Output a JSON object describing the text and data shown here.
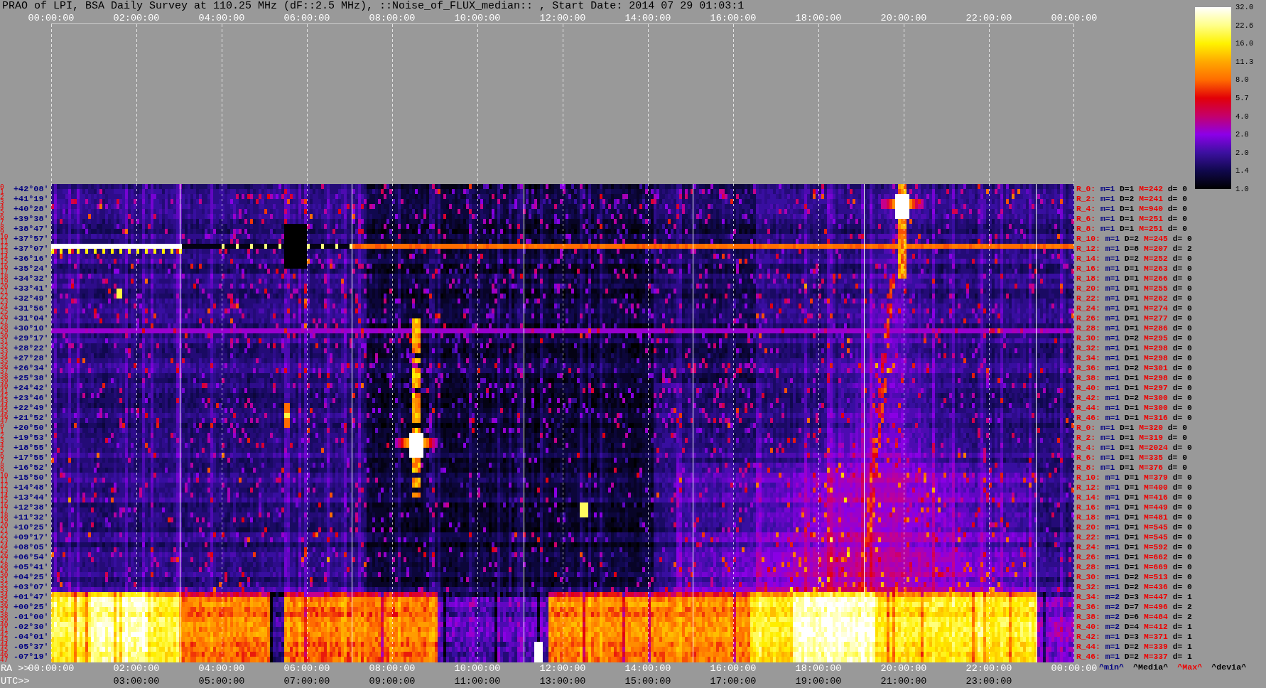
{
  "title": "PRAO of LPI, BSA Daily Survey at 110.25 MHz (dF::2.5 MHz), ::Noise_of_FLUX_median:: , Start Date: 2014 07 29 01:03:1",
  "top_axis": {
    "ticks": [
      "00:00:00",
      "02:00:00",
      "04:00:00",
      "06:00:00",
      "08:00:00",
      "10:00:00",
      "12:00:00",
      "14:00:00",
      "16:00:00",
      "18:00:00",
      "20:00:00",
      "22:00:00",
      "00:00:00"
    ]
  },
  "color_scale": {
    "ticks": [
      "32.0",
      "22.6",
      "16.0",
      "11.3",
      "8.0",
      "5.7",
      "4.0",
      "2.8",
      "2.0",
      "1.4",
      "1.0"
    ]
  },
  "declination_rows": [
    {
      "beams": [
        "0",
        "1"
      ],
      "declination": "+42°08′"
    },
    {
      "beams": [
        "2",
        "3"
      ],
      "declination": "+41°19′"
    },
    {
      "beams": [
        "4",
        "5"
      ],
      "declination": "+40°28′"
    },
    {
      "beams": [
        "6",
        "7"
      ],
      "declination": "+39°38′"
    },
    {
      "beams": [
        "8",
        "9"
      ],
      "declination": "+38°47′"
    },
    {
      "beams": [
        "10",
        "11"
      ],
      "declination": "+37°57′"
    },
    {
      "beams": [
        "12",
        "13"
      ],
      "declination": "+37°07′"
    },
    {
      "beams": [
        "14",
        "15"
      ],
      "declination": "+36°16′"
    },
    {
      "beams": [
        "16",
        "17"
      ],
      "declination": "+35°24′"
    },
    {
      "beams": [
        "18",
        "19"
      ],
      "declination": "+34°32′"
    },
    {
      "beams": [
        "20",
        "21"
      ],
      "declination": "+33°41′"
    },
    {
      "beams": [
        "22",
        "23"
      ],
      "declination": "+32°49′"
    },
    {
      "beams": [
        "24",
        "25"
      ],
      "declination": "+31°56′"
    },
    {
      "beams": [
        "26",
        "27"
      ],
      "declination": "+31°04′"
    },
    {
      "beams": [
        "28",
        "29"
      ],
      "declination": "+30°10′"
    },
    {
      "beams": [
        "30",
        "31"
      ],
      "declination": "+29°17′"
    },
    {
      "beams": [
        "32",
        "33"
      ],
      "declination": "+28°22′"
    },
    {
      "beams": [
        "34",
        "35"
      ],
      "declination": "+27°28′"
    },
    {
      "beams": [
        "36",
        "37"
      ],
      "declination": "+26°34′"
    },
    {
      "beams": [
        "38",
        "39"
      ],
      "declination": "+25°38′"
    },
    {
      "beams": [
        "40",
        "41"
      ],
      "declination": "+24°42′"
    },
    {
      "beams": [
        "42",
        "43"
      ],
      "declination": "+23°46′"
    },
    {
      "beams": [
        "44",
        "45"
      ],
      "declination": "+22°49′"
    },
    {
      "beams": [
        "46",
        "47"
      ],
      "declination": "+21°52′"
    },
    {
      "beams": [
        "0",
        "1"
      ],
      "declination": "+20°50′"
    },
    {
      "beams": [
        "2",
        "3"
      ],
      "declination": "+19°53′"
    },
    {
      "beams": [
        "4",
        "5"
      ],
      "declination": "+18°55′"
    },
    {
      "beams": [
        "6",
        "7"
      ],
      "declination": "+17°55′"
    },
    {
      "beams": [
        "8",
        "9"
      ],
      "declination": "+16°52′"
    },
    {
      "beams": [
        "10",
        "11"
      ],
      "declination": "+15°50′"
    },
    {
      "beams": [
        "12",
        "13"
      ],
      "declination": "+14°48′"
    },
    {
      "beams": [
        "14",
        "15"
      ],
      "declination": "+13°44′"
    },
    {
      "beams": [
        "16",
        "17"
      ],
      "declination": "+12°38′"
    },
    {
      "beams": [
        "18",
        "19"
      ],
      "declination": "+11°32′"
    },
    {
      "beams": [
        "20",
        "21"
      ],
      "declination": "+10°25′"
    },
    {
      "beams": [
        "22",
        "23"
      ],
      "declination": "+09°17′"
    },
    {
      "beams": [
        "24",
        "25"
      ],
      "declination": "+08°05′"
    },
    {
      "beams": [
        "26",
        "27"
      ],
      "declination": "+06°54′"
    },
    {
      "beams": [
        "28",
        "29"
      ],
      "declination": "+05°41′"
    },
    {
      "beams": [
        "30",
        "31"
      ],
      "declination": "+04°25′"
    },
    {
      "beams": [
        "32",
        "33"
      ],
      "declination": "+03°07′"
    },
    {
      "beams": [
        "34",
        "35"
      ],
      "declination": "+01°47′"
    },
    {
      "beams": [
        "36",
        "37"
      ],
      "declination": "+00°25′"
    },
    {
      "beams": [
        "38",
        "39"
      ],
      "declination": "-01°00′"
    },
    {
      "beams": [
        "40",
        "41"
      ],
      "declination": "-02°30′"
    },
    {
      "beams": [
        "42",
        "43"
      ],
      "declination": "-04°01′"
    },
    {
      "beams": [
        "44",
        "45"
      ],
      "declination": "-05°37′"
    },
    {
      "beams": [
        "46",
        "47"
      ],
      "declination": "-07°19′"
    }
  ],
  "statistics_rows": [
    {
      "beam": "R_0:",
      "min": "m=1",
      "median": "D=1",
      "max": "M=242",
      "deviation": "d= 0"
    },
    {
      "beam": "R_2:",
      "min": "m=1",
      "median": "D=2",
      "max": "M=241",
      "deviation": "d= 0"
    },
    {
      "beam": "R_4:",
      "min": "m=1",
      "median": "D=1",
      "max": "M=940",
      "deviation": "d= 0"
    },
    {
      "beam": "R_6:",
      "min": "m=1",
      "median": "D=1",
      "max": "M=251",
      "deviation": "d= 0"
    },
    {
      "beam": "R_8:",
      "min": "m=1",
      "median": "D=1",
      "max": "M=251",
      "deviation": "d= 0"
    },
    {
      "beam": "R_10:",
      "min": "m=1",
      "median": "D=2",
      "max": "M=245",
      "deviation": "d= 0"
    },
    {
      "beam": "R_12:",
      "min": "m=1",
      "median": "D=8",
      "max": "M=207",
      "deviation": "d= 2"
    },
    {
      "beam": "R_14:",
      "min": "m=1",
      "median": "D=2",
      "max": "M=252",
      "deviation": "d= 0"
    },
    {
      "beam": "R_16:",
      "min": "m=1",
      "median": "D=1",
      "max": "M=263",
      "deviation": "d= 0"
    },
    {
      "beam": "R_18:",
      "min": "m=1",
      "median": "D=1",
      "max": "M=266",
      "deviation": "d= 0"
    },
    {
      "beam": "R_20:",
      "min": "m=1",
      "median": "D=1",
      "max": "M=255",
      "deviation": "d= 0"
    },
    {
      "beam": "R_22:",
      "min": "m=1",
      "median": "D=1",
      "max": "M=262",
      "deviation": "d= 0"
    },
    {
      "beam": "R_24:",
      "min": "m=1",
      "median": "D=1",
      "max": "M=274",
      "deviation": "d= 0"
    },
    {
      "beam": "R_26:",
      "min": "m=1",
      "median": "D=1",
      "max": "M=277",
      "deviation": "d= 0"
    },
    {
      "beam": "R_28:",
      "min": "m=1",
      "median": "D=1",
      "max": "M=286",
      "deviation": "d= 0"
    },
    {
      "beam": "R_30:",
      "min": "m=1",
      "median": "D=2",
      "max": "M=295",
      "deviation": "d= 0"
    },
    {
      "beam": "R_32:",
      "min": "m=1",
      "median": "D=1",
      "max": "M=298",
      "deviation": "d= 0"
    },
    {
      "beam": "R_34:",
      "min": "m=1",
      "median": "D=1",
      "max": "M=298",
      "deviation": "d= 0"
    },
    {
      "beam": "R_36:",
      "min": "m=1",
      "median": "D=2",
      "max": "M=301",
      "deviation": "d= 0"
    },
    {
      "beam": "R_38:",
      "min": "m=1",
      "median": "D=1",
      "max": "M=298",
      "deviation": "d= 0"
    },
    {
      "beam": "R_40:",
      "min": "m=1",
      "median": "D=1",
      "max": "M=297",
      "deviation": "d= 0"
    },
    {
      "beam": "R_42:",
      "min": "m=1",
      "median": "D=2",
      "max": "M=300",
      "deviation": "d= 0"
    },
    {
      "beam": "R_44:",
      "min": "m=1",
      "median": "D=1",
      "max": "M=300",
      "deviation": "d= 0"
    },
    {
      "beam": "R_46:",
      "min": "m=1",
      "median": "D=1",
      "max": "M=316",
      "deviation": "d= 0"
    },
    {
      "beam": "R_0:",
      "min": "m=1",
      "median": "D=1",
      "max": "M=320",
      "deviation": "d= 0"
    },
    {
      "beam": "R_2:",
      "min": "m=1",
      "median": "D=1",
      "max": "M=319",
      "deviation": "d= 0"
    },
    {
      "beam": "R_4:",
      "min": "m=1",
      "median": "D=1",
      "max": "M=2024",
      "deviation": "d= 0"
    },
    {
      "beam": "R_6:",
      "min": "m=1",
      "median": "D=1",
      "max": "M=335",
      "deviation": "d= 0"
    },
    {
      "beam": "R_8:",
      "min": "m=1",
      "median": "D=1",
      "max": "M=376",
      "deviation": "d= 0"
    },
    {
      "beam": "R_10:",
      "min": "m=1",
      "median": "D=1",
      "max": "M=379",
      "deviation": "d= 0"
    },
    {
      "beam": "R_12:",
      "min": "m=1",
      "median": "D=1",
      "max": "M=400",
      "deviation": "d= 0"
    },
    {
      "beam": "R_14:",
      "min": "m=1",
      "median": "D=1",
      "max": "M=416",
      "deviation": "d= 0"
    },
    {
      "beam": "R_16:",
      "min": "m=1",
      "median": "D=1",
      "max": "M=449",
      "deviation": "d= 0"
    },
    {
      "beam": "R_18:",
      "min": "m=1",
      "median": "D=1",
      "max": "M=481",
      "deviation": "d= 0"
    },
    {
      "beam": "R_20:",
      "min": "m=1",
      "median": "D=1",
      "max": "M=545",
      "deviation": "d= 0"
    },
    {
      "beam": "R_22:",
      "min": "m=1",
      "median": "D=1",
      "max": "M=545",
      "deviation": "d= 0"
    },
    {
      "beam": "R_24:",
      "min": "m=1",
      "median": "D=1",
      "max": "M=592",
      "deviation": "d= 0"
    },
    {
      "beam": "R_26:",
      "min": "m=1",
      "median": "D=1",
      "max": "M=662",
      "deviation": "d= 0"
    },
    {
      "beam": "R_28:",
      "min": "m=1",
      "median": "D=1",
      "max": "M=669",
      "deviation": "d= 0"
    },
    {
      "beam": "R_30:",
      "min": "m=1",
      "median": "D=2",
      "max": "M=513",
      "deviation": "d= 0"
    },
    {
      "beam": "R_32:",
      "min": "m=1",
      "median": "D=2",
      "max": "M=436",
      "deviation": "d= 0"
    },
    {
      "beam": "R_34:",
      "min": "m=2",
      "median": "D=3",
      "max": "M=447",
      "deviation": "d= 1"
    },
    {
      "beam": "R_36:",
      "min": "m=2",
      "median": "D=7",
      "max": "M=496",
      "deviation": "d= 2"
    },
    {
      "beam": "R_38:",
      "min": "m=2",
      "median": "D=6",
      "max": "M=484",
      "deviation": "d= 2"
    },
    {
      "beam": "R_40:",
      "min": "m=2",
      "median": "D=4",
      "max": "M=412",
      "deviation": "d= 1"
    },
    {
      "beam": "R_42:",
      "min": "m=1",
      "median": "D=3",
      "max": "M=371",
      "deviation": "d= 1"
    },
    {
      "beam": "R_44:",
      "min": "m=1",
      "median": "D=2",
      "max": "M=339",
      "deviation": "d= 1"
    },
    {
      "beam": "R_46:",
      "min": "m=1",
      "median": "D=2",
      "max": "M=337",
      "deviation": "d= 1"
    }
  ],
  "statistics_legend": [
    {
      "kind": "min",
      "text": "^min^"
    },
    {
      "kind": "median",
      "text": "^Media^"
    },
    {
      "kind": "max",
      "text": "^Max^"
    },
    {
      "kind": "deviation",
      "text": "^devia^"
    }
  ],
  "bottom_axis": {
    "ra_prefix": "RA >>",
    "ra_ticks": [
      "00:00:00",
      "02:00:00",
      "04:00:00",
      "06:00:00",
      "08:00:00",
      "10:00:00",
      "12:00:00",
      "14:00:00",
      "16:00:00",
      "18:00:00",
      "20:00:00",
      "22:00:00",
      "00:00:00"
    ],
    "utc_prefix": "UTC>>",
    "utc_ticks": [
      "03:00:00",
      "05:00:00",
      "07:00:00",
      "09:00:00",
      "11:00:00",
      "13:00:00",
      "15:00:00",
      "17:00:00",
      "19:00:00",
      "21:00:00",
      "23:00:00"
    ]
  }
}
